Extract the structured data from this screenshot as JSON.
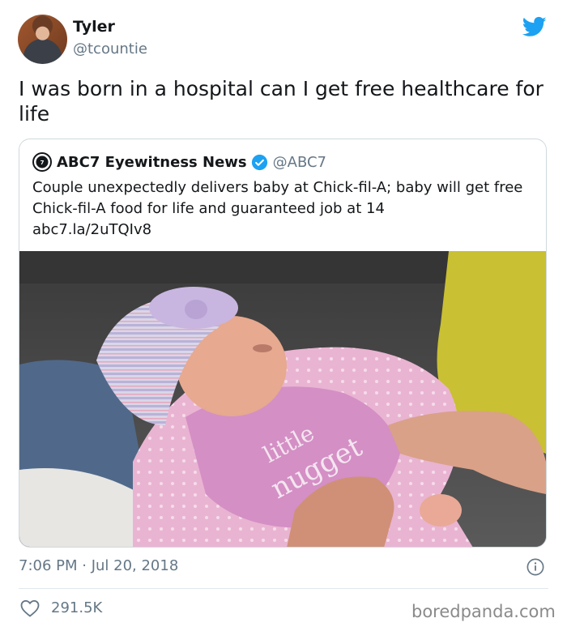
{
  "tweet": {
    "author_name": "Tyler",
    "author_handle": "@tcountie",
    "text": "I was born in a hospital can I get free healthcare for life",
    "timestamp": "7:06 PM · Jul 20, 2018",
    "likes": "291.5K"
  },
  "quoted_tweet": {
    "author_name": "ABC7 Eyewitness News",
    "author_handle": "@ABC7",
    "text": "Couple unexpectedly delivers baby at Chick-fil-A; baby will get free Chick-fil-A food for life and guaranteed job at 14",
    "link": "abc7.la/2uTQIv8",
    "photo_shirt_text": [
      "little",
      "nugget"
    ]
  },
  "watermark": "boredpanda.com",
  "icons": {
    "brand": "twitter-bird-icon",
    "verified": "verified-badge-icon",
    "info": "info-icon",
    "like": "heart-icon",
    "news_logo": "abc7-logo-icon"
  },
  "colors": {
    "twitter_blue": "#1da1f2",
    "secondary_text": "#657786",
    "border": "#cfd9de"
  }
}
